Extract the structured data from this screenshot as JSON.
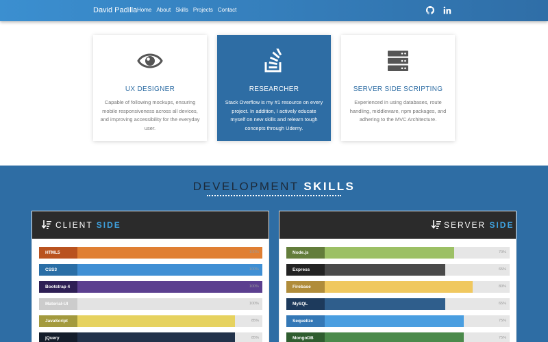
{
  "navbar": {
    "brand": "David Padilla",
    "links": [
      "Home",
      "About",
      "Skills",
      "Projects",
      "Contact"
    ]
  },
  "cards": [
    {
      "icon": "eye-icon",
      "title": "UX DESIGNER",
      "description": "Capable of following mockups, ensuring mobile responsiveness across all devices, and improving accessibility for the everyday user."
    },
    {
      "icon": "stack-overflow-icon",
      "title": "RESEARCHER",
      "description": "Stack Overflow is my #1 resource on every project. In addition, I actively educate myself on new skills and relearn tough concepts through Udemy."
    },
    {
      "icon": "server-icon",
      "title": "SERVER SIDE SCRIPTING",
      "description": "Experienced in using databases, route handling, middleware, npm packages, and adhering to the MVC Architecture."
    }
  ],
  "skills": {
    "title_light": "DEVELOPMENT ",
    "title_bold": "SKILLS",
    "client": {
      "title_light": "CLIENT ",
      "title_accent": "SIDE",
      "items": [
        {
          "label": "HTML5",
          "percent": 100,
          "percent_label": "100%",
          "label_color": "#b9521f",
          "bar_color": "#e07f33"
        },
        {
          "label": "CSS3",
          "percent": 100,
          "percent_label": "100%",
          "label_color": "#2a6ea6",
          "bar_color": "#3f8fd4"
        },
        {
          "label": "Bootstrap 4",
          "percent": 100,
          "percent_label": "100%",
          "label_color": "#2e1f55",
          "bar_color": "#5b3f8f"
        },
        {
          "label": "Material-UI",
          "percent": 100,
          "percent_label": "100%",
          "label_color": "#cccccc",
          "bar_color": "#e3e3e3"
        },
        {
          "label": "JavaScript",
          "percent": 85,
          "percent_label": "85%",
          "label_color": "#a39a3e",
          "bar_color": "#e6d25f"
        },
        {
          "label": "jQuery",
          "percent": 85,
          "percent_label": "85%",
          "label_color": "#141d2b",
          "bar_color": "#22324a"
        }
      ]
    },
    "server": {
      "title_light": "SERVER ",
      "title_accent": "SIDE",
      "items": [
        {
          "label": "Node.js",
          "percent": 70,
          "percent_label": "70%",
          "label_color": "#637d3b",
          "bar_color": "#9cc065"
        },
        {
          "label": "Express",
          "percent": 65,
          "percent_label": "65%",
          "label_color": "#232323",
          "bar_color": "#4a4a4a"
        },
        {
          "label": "Firebase",
          "percent": 80,
          "percent_label": "80%",
          "label_color": "#b08c3a",
          "bar_color": "#f0c85f"
        },
        {
          "label": "MySQL",
          "percent": 65,
          "percent_label": "65%",
          "label_color": "#1d3a5c",
          "bar_color": "#2f5e8c"
        },
        {
          "label": "Sequelize",
          "percent": 75,
          "percent_label": "75%",
          "label_color": "#3478b6",
          "bar_color": "#4a9ee0"
        },
        {
          "label": "MongoDB",
          "percent": 75,
          "percent_label": "75%",
          "label_color": "#2f5d2f",
          "bar_color": "#4b8a4b"
        }
      ]
    }
  }
}
